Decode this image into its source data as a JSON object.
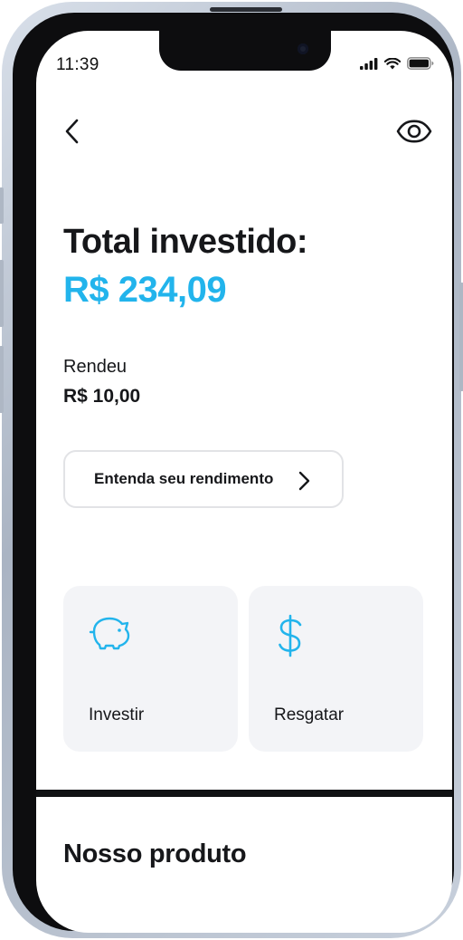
{
  "status_bar": {
    "time": "11:39"
  },
  "header": {
    "back_icon": "chevron-left-icon",
    "visibility_icon": "eye-icon"
  },
  "summary": {
    "title": "Total investido:",
    "total": "R$ 234,09",
    "yield_label": "Rendeu",
    "yield_value": "R$ 10,00",
    "total_color": "#22b4ec"
  },
  "understand_button": {
    "label": "Entenda seu rendimento",
    "icon": "chevron-right-icon"
  },
  "actions": [
    {
      "label": "Investir",
      "icon": "piggy-bank-icon"
    },
    {
      "label": "Resgatar",
      "icon": "dollar-sign-icon"
    }
  ],
  "product_section": {
    "title": "Nosso produto"
  },
  "colors": {
    "accent": "#22b4ec",
    "card_bg": "#f3f4f7",
    "text": "#16171a"
  }
}
